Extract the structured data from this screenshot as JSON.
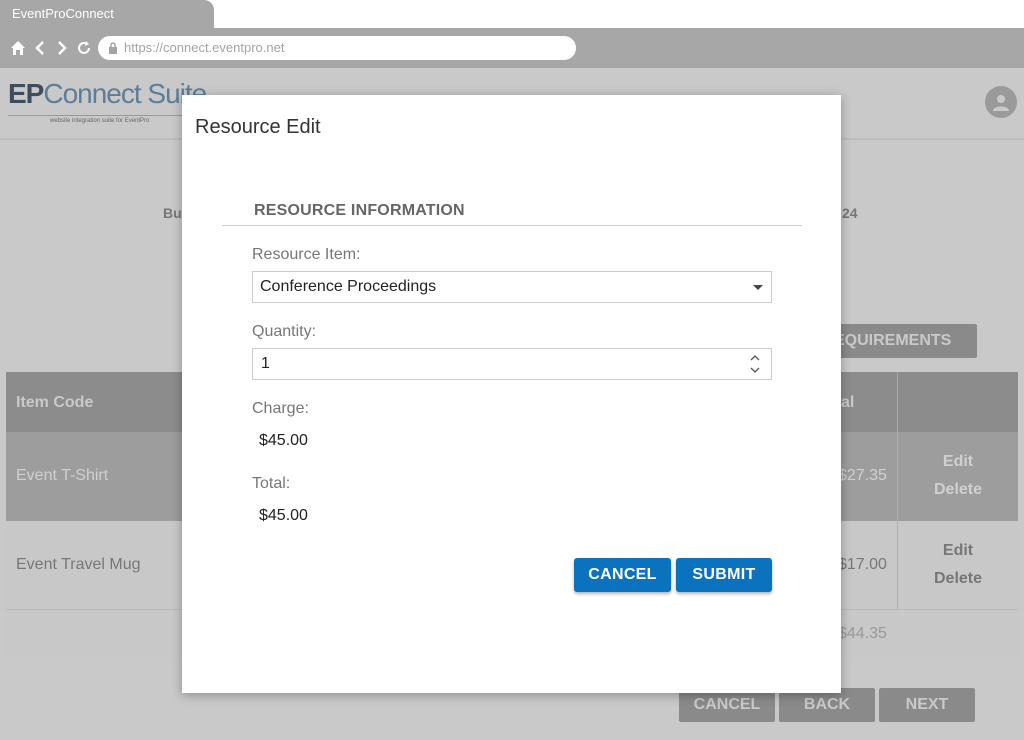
{
  "browser": {
    "tab_title": "EventProConnect",
    "url": "https://connect.eventpro.net"
  },
  "app": {
    "logo_ep": "EP",
    "logo_connect": "Connect Suite",
    "logo_tagline": "website integration suite for EventPro"
  },
  "background": {
    "label_left": "Bu",
    "label_right": "24",
    "requirements_button": "EQUIREMENTS",
    "table": {
      "headers": {
        "item_code": "Item Code",
        "total": "al"
      },
      "rows": [
        {
          "item": "Event T-Shirt",
          "total": "$27.35",
          "edit": "Edit",
          "delete": "Delete"
        },
        {
          "item": "Event Travel Mug",
          "total": "$17.00",
          "edit": "Edit",
          "delete": "Delete"
        }
      ],
      "grand_total": "$44.35"
    },
    "footer": {
      "cancel": "CANCEL",
      "back": "BACK",
      "next": "NEXT"
    }
  },
  "modal": {
    "title": "Resource Edit",
    "section_title": "RESOURCE INFORMATION",
    "resource_item": {
      "label": "Resource Item:",
      "value": "Conference Proceedings"
    },
    "quantity": {
      "label": "Quantity:",
      "value": "1"
    },
    "charge": {
      "label": "Charge:",
      "value": "$45.00"
    },
    "total": {
      "label": "Total:",
      "value": "$45.00"
    },
    "cancel_label": "CANCEL",
    "submit_label": "SUBMIT"
  },
  "colors": {
    "primary_button": "#0b72bd",
    "overlay": "#cfcfcf"
  }
}
